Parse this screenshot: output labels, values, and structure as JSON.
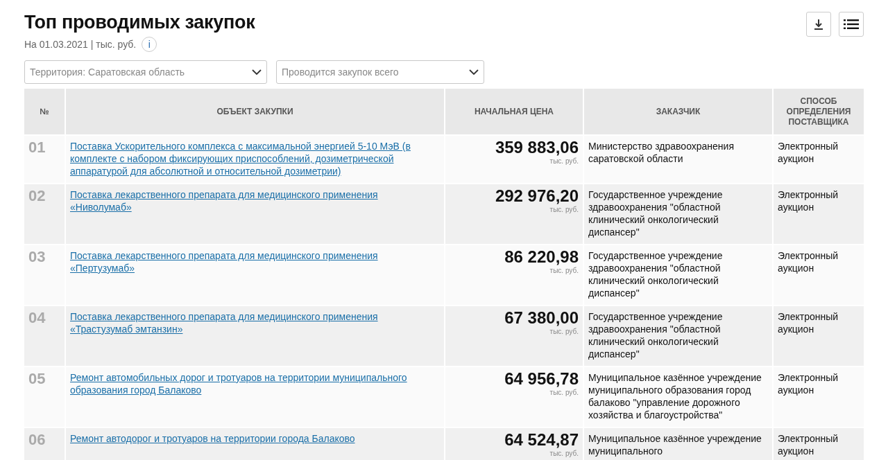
{
  "header": {
    "title": "Топ проводимых закупок",
    "subtitle": "На 01.03.2021 | тыс. руб.",
    "info": "i"
  },
  "filters": [
    {
      "value": "Территория: Саратовская область"
    },
    {
      "value": "Проводится закупок всего"
    }
  ],
  "table": {
    "columns": [
      "№",
      "ОБЪЕКТ ЗАКУПКИ",
      "НАЧАЛЬНАЯ ЦЕНА",
      "ЗАКАЗЧИК",
      "СПОСОБ ОПРЕДЕЛЕНИЯ ПОСТАВЩИКА"
    ],
    "rows": [
      {
        "number": "01",
        "object": "Поставка Ускорительного комплекса с максимальной энергией 5-10 МэВ (в комплекте с набором фиксирующих приспособлений, дозиметрической аппаратурой для абсолютной и относительной дозиметрии)",
        "price": "359 883,06",
        "unit": "тыс. руб.",
        "customer": "Министерство здравоохранения саратовской области",
        "method": "Электронный аукцион"
      },
      {
        "number": "02",
        "object": "Поставка лекарственного препарата для медицинского применения «Ниволумаб»",
        "price": "292 976,20",
        "unit": "тыс. руб.",
        "customer": "Государственное учреждение здравоохранения \"областной клинический онкологический диспансер\"",
        "method": "Электронный аукцион"
      },
      {
        "number": "03",
        "object": "Поставка лекарственного препарата для медицинского применения «Пертузумаб»",
        "price": "86 220,98",
        "unit": "тыс. руб.",
        "customer": "Государственное учреждение здравоохранения \"областной клинический онкологический диспансер\"",
        "method": "Электронный аукцион"
      },
      {
        "number": "04",
        "object": "Поставка лекарственного препарата для медицинского применения «Трастузумаб эмтанзин»",
        "price": "67 380,00",
        "unit": "тыс. руб.",
        "customer": "Государственное учреждение здравоохранения \"областной клинический онкологический диспансер\"",
        "method": "Электронный аукцион"
      },
      {
        "number": "05",
        "object": "Ремонт автомобильных дорог и тротуаров на территории муниципального образования город Балаково",
        "price": "64 956,78",
        "unit": "тыс. руб.",
        "customer": "Муниципальное казённое учреждение муниципального образования город балаково \"управление дорожного хозяйства и благоустройства\"",
        "method": "Электронный аукцион"
      },
      {
        "number": "06",
        "object": "Ремонт автодорог и тротуаров на территории города Балаково",
        "price": "64 524,87",
        "unit": "тыс. руб.",
        "customer": "Муниципальное казённое учреждение муниципального",
        "method": "Электронный аукцион"
      }
    ]
  }
}
